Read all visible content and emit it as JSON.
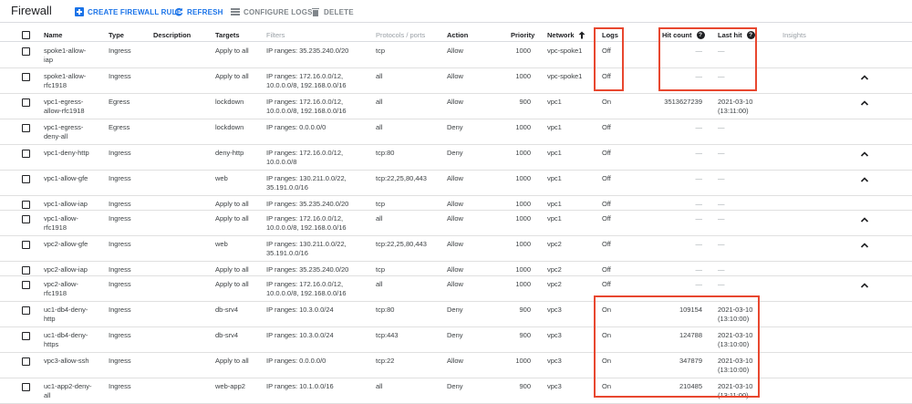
{
  "toolbar": {
    "title": "Firewall",
    "create_label": "CREATE FIREWALL RULE",
    "refresh_label": "REFRESH",
    "configure_label": "CONFIGURE LOGS",
    "delete_label": "DELETE"
  },
  "columns": {
    "name": "Name",
    "type": "Type",
    "description": "Description",
    "targets": "Targets",
    "filters": "Filters",
    "protocols": "Protocols / ports",
    "action": "Action",
    "priority": "Priority",
    "network": "Network",
    "logs": "Logs",
    "hit_count": "Hit count",
    "last_hit": "Last hit",
    "insights": "Insights"
  },
  "rows": [
    {
      "name": [
        "spoke1-allow-",
        "iap"
      ],
      "type": "Ingress",
      "targets": "Apply to all",
      "filters": [
        "IP ranges: 35.235.240.0/20"
      ],
      "protocols": [
        "tcp"
      ],
      "action": "Allow",
      "priority": "1000",
      "network": "vpc-spoke1",
      "logs": "Off",
      "hit_count": "—",
      "last_hit": [
        "—"
      ],
      "chevron": false
    },
    {
      "name": [
        "spoke1-allow-",
        "rfc1918"
      ],
      "type": "Ingress",
      "targets": "Apply to all",
      "filters": [
        "IP ranges: 172.16.0.0/12,",
        "10.0.0.0/8, 192.168.0.0/16"
      ],
      "protocols": [
        "all"
      ],
      "action": "Allow",
      "priority": "1000",
      "network": "vpc-spoke1",
      "logs": "Off",
      "hit_count": "—",
      "last_hit": [
        "—"
      ],
      "chevron": true
    },
    {
      "name": [
        "vpc1-egress-",
        "allow-rfc1918"
      ],
      "type": "Egress",
      "targets": "lockdown",
      "filters": [
        "IP ranges: 172.16.0.0/12,",
        "10.0.0.0/8, 192.168.0.0/16"
      ],
      "protocols": [
        "all"
      ],
      "action": "Allow",
      "priority": "900",
      "network": "vpc1",
      "logs": "On",
      "hit_count": "3513627239",
      "last_hit": [
        "2021-03-10",
        "(13:11:00)"
      ],
      "chevron": true
    },
    {
      "name": [
        "vpc1-egress-",
        "deny-all"
      ],
      "type": "Egress",
      "targets": "lockdown",
      "filters": [
        "IP ranges: 0.0.0.0/0"
      ],
      "protocols": [
        "all"
      ],
      "action": "Deny",
      "priority": "1000",
      "network": "vpc1",
      "logs": "Off",
      "hit_count": "—",
      "last_hit": [
        "—"
      ],
      "chevron": false
    },
    {
      "name": [
        "vpc1-deny-http"
      ],
      "type": "Ingress",
      "targets": "deny-http",
      "filters": [
        "IP ranges: 172.16.0.0/12,",
        "10.0.0.0/8"
      ],
      "protocols": [
        "tcp:80"
      ],
      "action": "Deny",
      "priority": "1000",
      "network": "vpc1",
      "logs": "Off",
      "hit_count": "—",
      "last_hit": [
        "—"
      ],
      "chevron": true
    },
    {
      "name": [
        "vpc1-allow-gfe"
      ],
      "type": "Ingress",
      "targets": "web",
      "filters": [
        "IP ranges: 130.211.0.0/22,",
        "35.191.0.0/16"
      ],
      "protocols": [
        "tcp:22,25,80,443"
      ],
      "action": "Allow",
      "priority": "1000",
      "network": "vpc1",
      "logs": "Off",
      "hit_count": "—",
      "last_hit": [
        "—"
      ],
      "chevron": true
    },
    {
      "name": [
        "vpc1-allow-iap"
      ],
      "type": "Ingress",
      "targets": "Apply to all",
      "filters": [
        "IP ranges: 35.235.240.0/20"
      ],
      "protocols": [
        "tcp"
      ],
      "action": "Allow",
      "priority": "1000",
      "network": "vpc1",
      "logs": "Off",
      "hit_count": "—",
      "last_hit": [
        "—"
      ],
      "chevron": false
    },
    {
      "name": [
        "vpc1-allow-",
        "rfc1918"
      ],
      "type": "Ingress",
      "targets": "Apply to all",
      "filters": [
        "IP ranges: 172.16.0.0/12,",
        "10.0.0.0/8, 192.168.0.0/16"
      ],
      "protocols": [
        "all"
      ],
      "action": "Allow",
      "priority": "1000",
      "network": "vpc1",
      "logs": "Off",
      "hit_count": "—",
      "last_hit": [
        "—"
      ],
      "chevron": true
    },
    {
      "name": [
        "vpc2-allow-gfe"
      ],
      "type": "Ingress",
      "targets": "web",
      "filters": [
        "IP ranges: 130.211.0.0/22,",
        "35.191.0.0/16"
      ],
      "protocols": [
        "tcp:22,25,80,443"
      ],
      "action": "Allow",
      "priority": "1000",
      "network": "vpc2",
      "logs": "Off",
      "hit_count": "—",
      "last_hit": [
        "—"
      ],
      "chevron": true
    },
    {
      "name": [
        "vpc2-allow-iap"
      ],
      "type": "Ingress",
      "targets": "Apply to all",
      "filters": [
        "IP ranges: 35.235.240.0/20"
      ],
      "protocols": [
        "tcp"
      ],
      "action": "Allow",
      "priority": "1000",
      "network": "vpc2",
      "logs": "Off",
      "hit_count": "—",
      "last_hit": [
        "—"
      ],
      "chevron": false
    },
    {
      "name": [
        "vpc2-allow-",
        "rfc1918"
      ],
      "type": "Ingress",
      "targets": "Apply to all",
      "filters": [
        "IP ranges: 172.16.0.0/12,",
        "10.0.0.0/8, 192.168.0.0/16"
      ],
      "protocols": [
        "all"
      ],
      "action": "Allow",
      "priority": "1000",
      "network": "vpc2",
      "logs": "Off",
      "hit_count": "—",
      "last_hit": [
        "—"
      ],
      "chevron": true
    },
    {
      "name": [
        "uc1-db4-deny-",
        "http"
      ],
      "type": "Ingress",
      "targets": "db-srv4",
      "filters": [
        "IP ranges: 10.3.0.0/24"
      ],
      "protocols": [
        "tcp:80"
      ],
      "action": "Deny",
      "priority": "900",
      "network": "vpc3",
      "logs": "On",
      "hit_count": "109154",
      "last_hit": [
        "2021-03-10",
        "(13:10:00)"
      ],
      "chevron": false
    },
    {
      "name": [
        "uc1-db4-deny-",
        "https"
      ],
      "type": "Ingress",
      "targets": "db-srv4",
      "filters": [
        "IP ranges: 10.3.0.0/24"
      ],
      "protocols": [
        "tcp:443"
      ],
      "action": "Deny",
      "priority": "900",
      "network": "vpc3",
      "logs": "On",
      "hit_count": "124788",
      "last_hit": [
        "2021-03-10",
        "(13:10:00)"
      ],
      "chevron": false
    },
    {
      "name": [
        "vpc3-allow-ssh"
      ],
      "type": "Ingress",
      "targets": "Apply to all",
      "filters": [
        "IP ranges: 0.0.0.0/0"
      ],
      "protocols": [
        "tcp:22"
      ],
      "action": "Allow",
      "priority": "1000",
      "network": "vpc3",
      "logs": "On",
      "hit_count": "347879",
      "last_hit": [
        "2021-03-10",
        "(13:10:00)"
      ],
      "chevron": false
    },
    {
      "name": [
        "uc1-app2-deny-",
        "all"
      ],
      "type": "Ingress",
      "targets": "web-app2",
      "filters": [
        "IP ranges: 10.1.0.0/16"
      ],
      "protocols": [
        "all"
      ],
      "action": "Deny",
      "priority": "900",
      "network": "vpc3",
      "logs": "On",
      "hit_count": "210485",
      "last_hit": [
        "2021-03-10",
        "(13:11:00)"
      ],
      "chevron": false
    }
  ],
  "colors": {
    "accent": "#1a73e8",
    "highlight": "#e8472f",
    "divider": "#e0e0e0"
  },
  "icons": {
    "create": "add-box-icon",
    "refresh": "refresh-icon",
    "configure": "list-icon",
    "delete": "trash-icon",
    "sort": "arrow-up-icon",
    "help": "help-icon",
    "expand": "chevron-up-icon"
  }
}
